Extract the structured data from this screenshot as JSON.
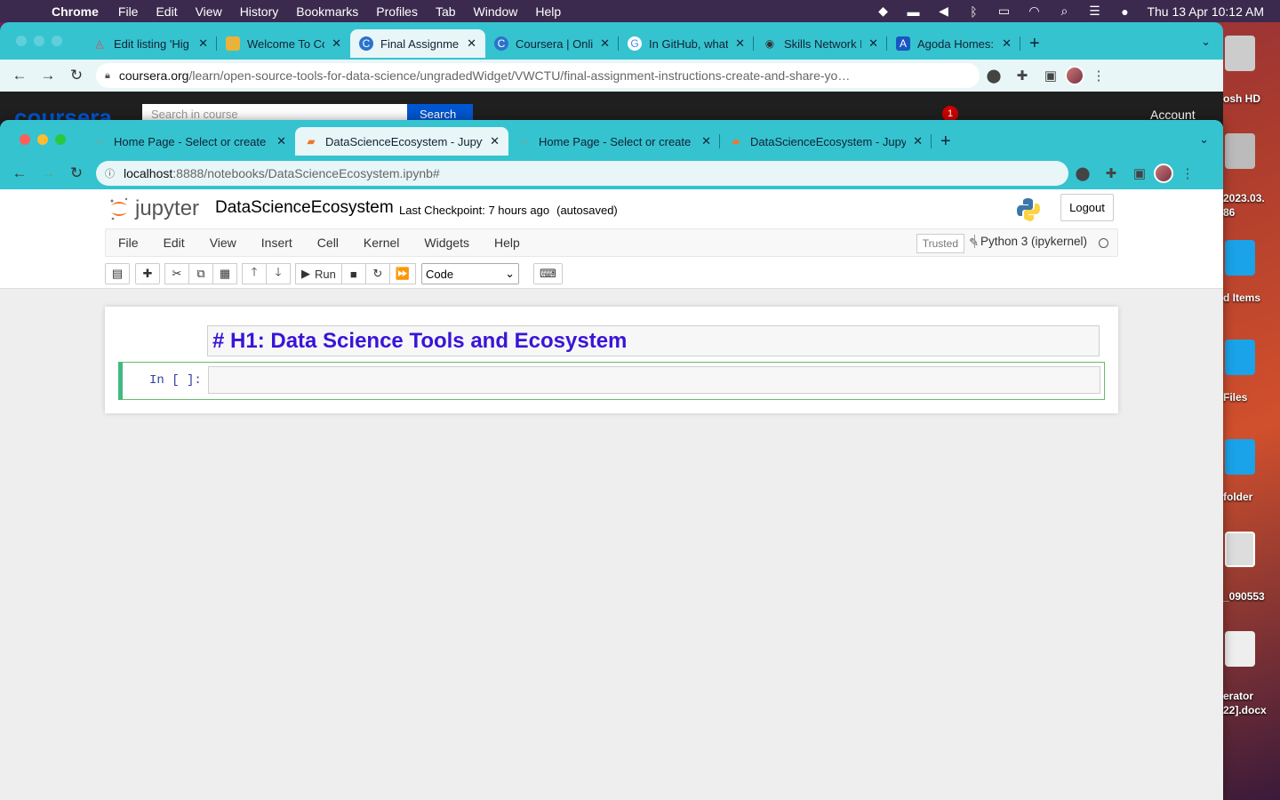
{
  "menubar": {
    "app": "Chrome",
    "items": [
      "File",
      "Edit",
      "View",
      "History",
      "Bookmarks",
      "Profiles",
      "Tab",
      "Window",
      "Help"
    ],
    "clock": "Thu 13 Apr  10:12 AM"
  },
  "desktop": {
    "labels": [
      "osh HD",
      "2023.03.",
      "86",
      "d Items",
      "Files",
      "folder",
      "_090553",
      "erator",
      "22].docx"
    ]
  },
  "back_window": {
    "tabs": [
      "Edit listing 'Hig",
      "Welcome To Co",
      "Final Assignme",
      "Coursera | Onli",
      "In GitHub, what",
      "Skills Network L",
      "Agoda Homes:"
    ],
    "url_host": "coursera.org",
    "url_path": "/learn/open-source-tools-for-data-science/ungradedWidget/VWCTU/final-assignment-instructions-create-and-share-yo…",
    "page_peek": {
      "logo": "coursera",
      "search_placeholder": "Search in course",
      "search_btn": "Search",
      "badge": "1",
      "account": "Account"
    }
  },
  "front_window": {
    "tabs": [
      "Home Page - Select or create a",
      "DataScienceEcosystem - Jupyte",
      "Home Page - Select or create a",
      "DataScienceEcosystem - Jupyte"
    ],
    "url_host": "localhost",
    "url_path": ":8888/notebooks/DataScienceEcosystem.ipynb#"
  },
  "jupyter": {
    "logo_text": "jupyter",
    "notebook_name": "DataScienceEcosystem",
    "checkpoint": "Last Checkpoint: 7 hours ago",
    "autosaved": "(autosaved)",
    "logout": "Logout",
    "menu": [
      "File",
      "Edit",
      "View",
      "Insert",
      "Cell",
      "Kernel",
      "Widgets",
      "Help"
    ],
    "trusted": "Trusted",
    "kernel": "Python 3 (ipykernel)",
    "run": "Run",
    "cell_type": "Code",
    "markdown_cell": "# H1: Data Science Tools and Ecosystem",
    "prompt": "In [ ]:"
  },
  "colors": {
    "chrome_teal": "#35c3d0",
    "heading": "#3a14d8",
    "cell_border": "#42b983"
  }
}
